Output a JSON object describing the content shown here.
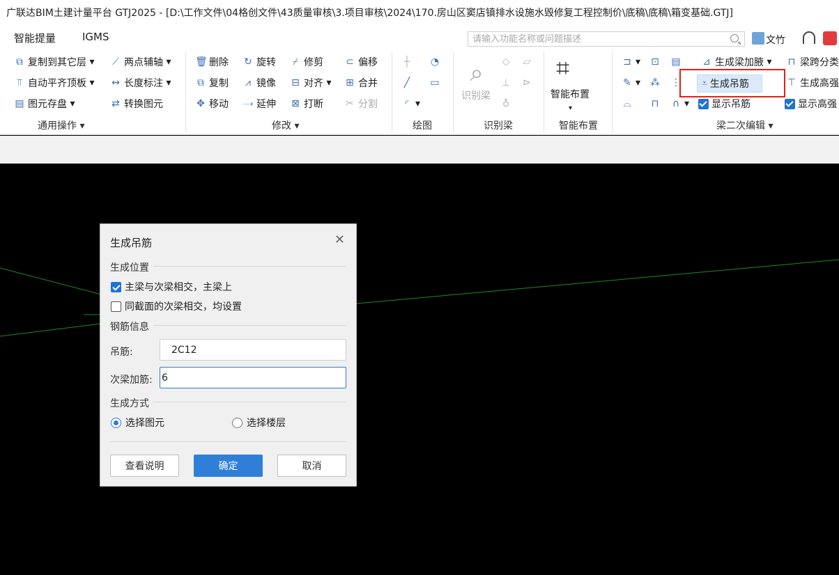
{
  "window": {
    "title": "广联达BIM土建计量平台 GTJ2025 - [D:\\工作文件\\04格创文件\\43质量审核\\3.项目审核\\2024\\170.房山区窦店镇排水设施水毁修复工程控制价\\底稿\\底稿\\箱变基础.GTJ]"
  },
  "menu": {
    "tabs": [
      "智能提量",
      "IGMS"
    ],
    "search_placeholder": "请输入功能名称或问题描述",
    "user": "文竹"
  },
  "ribbon": {
    "general": {
      "label": "通用操作",
      "items": [
        "复制到其它层",
        "自动平齐顶板",
        "图元存盘",
        "两点辅轴",
        "长度标注",
        "转换图元"
      ]
    },
    "modify": {
      "label": "修改",
      "items": [
        "删除",
        "旋转",
        "修剪",
        "偏移",
        "复制",
        "镜像",
        "对齐",
        "合并",
        "移动",
        "延伸",
        "打断",
        "分割"
      ]
    },
    "draw": {
      "label": "绘图"
    },
    "identify": {
      "label": "识别梁",
      "button": "识别梁"
    },
    "smart": {
      "label": "智能布置",
      "button": "智能布置"
    },
    "beam2": {
      "label": "梁二次编辑",
      "gen_haunch": "生成梁加腋",
      "span_partial": "梁跨分类",
      "gen_hanger": "生成吊筋",
      "gen_height": "生成高强",
      "show_hanger": "显示吊筋",
      "show_height": "显示高强"
    }
  },
  "dialog": {
    "title": "生成吊筋",
    "position_section": "生成位置",
    "opt1": "主梁与次梁相交，主梁上",
    "opt1_checked": true,
    "opt2": "同截面的次梁相交，均设置",
    "opt2_checked": false,
    "rebar_section": "钢筋信息",
    "hanger_label": "吊筋:",
    "hanger_value": "2C12",
    "secondary_label": "次梁加筋:",
    "secondary_value": "6",
    "method_section": "生成方式",
    "radio1": "选择图元",
    "radio2": "选择楼层",
    "radio_selected": "选择图元",
    "btn_help": "查看说明",
    "btn_ok": "确定",
    "btn_cancel": "取消"
  }
}
